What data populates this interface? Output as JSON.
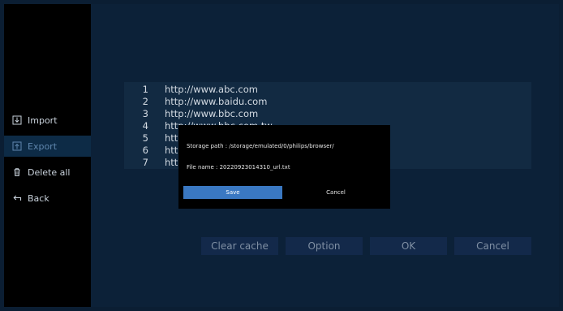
{
  "sidebar": {
    "items": [
      {
        "label": "Import",
        "icon": "import-icon"
      },
      {
        "label": "Export",
        "icon": "export-icon"
      },
      {
        "label": "Delete all",
        "icon": "trash-icon"
      },
      {
        "label": "Back",
        "icon": "back-arrow-icon"
      }
    ],
    "selected": "Export"
  },
  "url_list": {
    "rows": [
      {
        "num": "1",
        "url": "http://www.abc.com"
      },
      {
        "num": "2",
        "url": "http://www.baidu.com"
      },
      {
        "num": "3",
        "url": "http://www.bbc.com"
      },
      {
        "num": "4",
        "url": "http://www.bbc.com.tw"
      },
      {
        "num": "5",
        "url": "htt"
      },
      {
        "num": "6",
        "url": "htt"
      },
      {
        "num": "7",
        "url": "htt"
      }
    ]
  },
  "dialog": {
    "storage_path": "Storage path : /storage/emulated/0/philips/browser/",
    "file_name": "File name : 20220923014310_url.txt",
    "save_label": "Save",
    "cancel_label": "Cancel"
  },
  "bottom_buttons": {
    "clear_cache": "Clear cache",
    "option": "Option",
    "ok": "OK",
    "cancel": "Cancel"
  },
  "colors": {
    "background": "#0b1e33",
    "sidebar": "#000000",
    "selected_item": "#0d2b46",
    "save_button": "#3a78c2",
    "bottom_button": "#13294a"
  }
}
